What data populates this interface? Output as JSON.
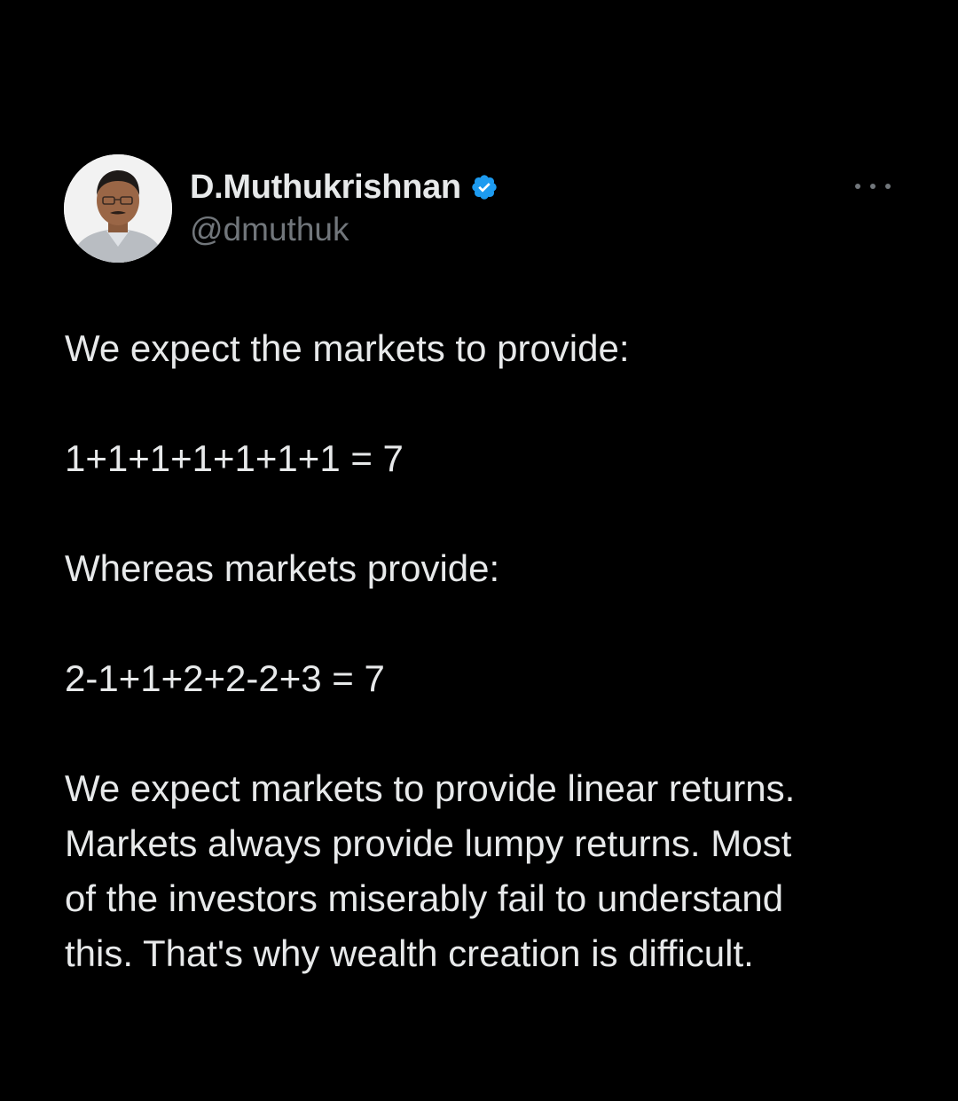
{
  "tweet": {
    "author": {
      "display_name": "D.Muthukrishnan",
      "handle": "@dmuthuk",
      "verified": true,
      "verified_color": "#1d9bf0"
    },
    "more_options_icon": "ellipsis-icon",
    "lines": [
      "We expect the markets to provide:",
      "1+1+1+1+1+1+1 = 7",
      "Whereas markets provide:",
      "2-1+1+2+2-2+3 = 7",
      "We expect markets to provide linear returns.",
      "Markets always provide lumpy returns. Most",
      "of the investors miserably fail to understand",
      "this. That's why wealth creation is difficult."
    ]
  },
  "theme": {
    "background": "#000000",
    "text": "#e7e9ea",
    "secondary_text": "#71767b"
  }
}
